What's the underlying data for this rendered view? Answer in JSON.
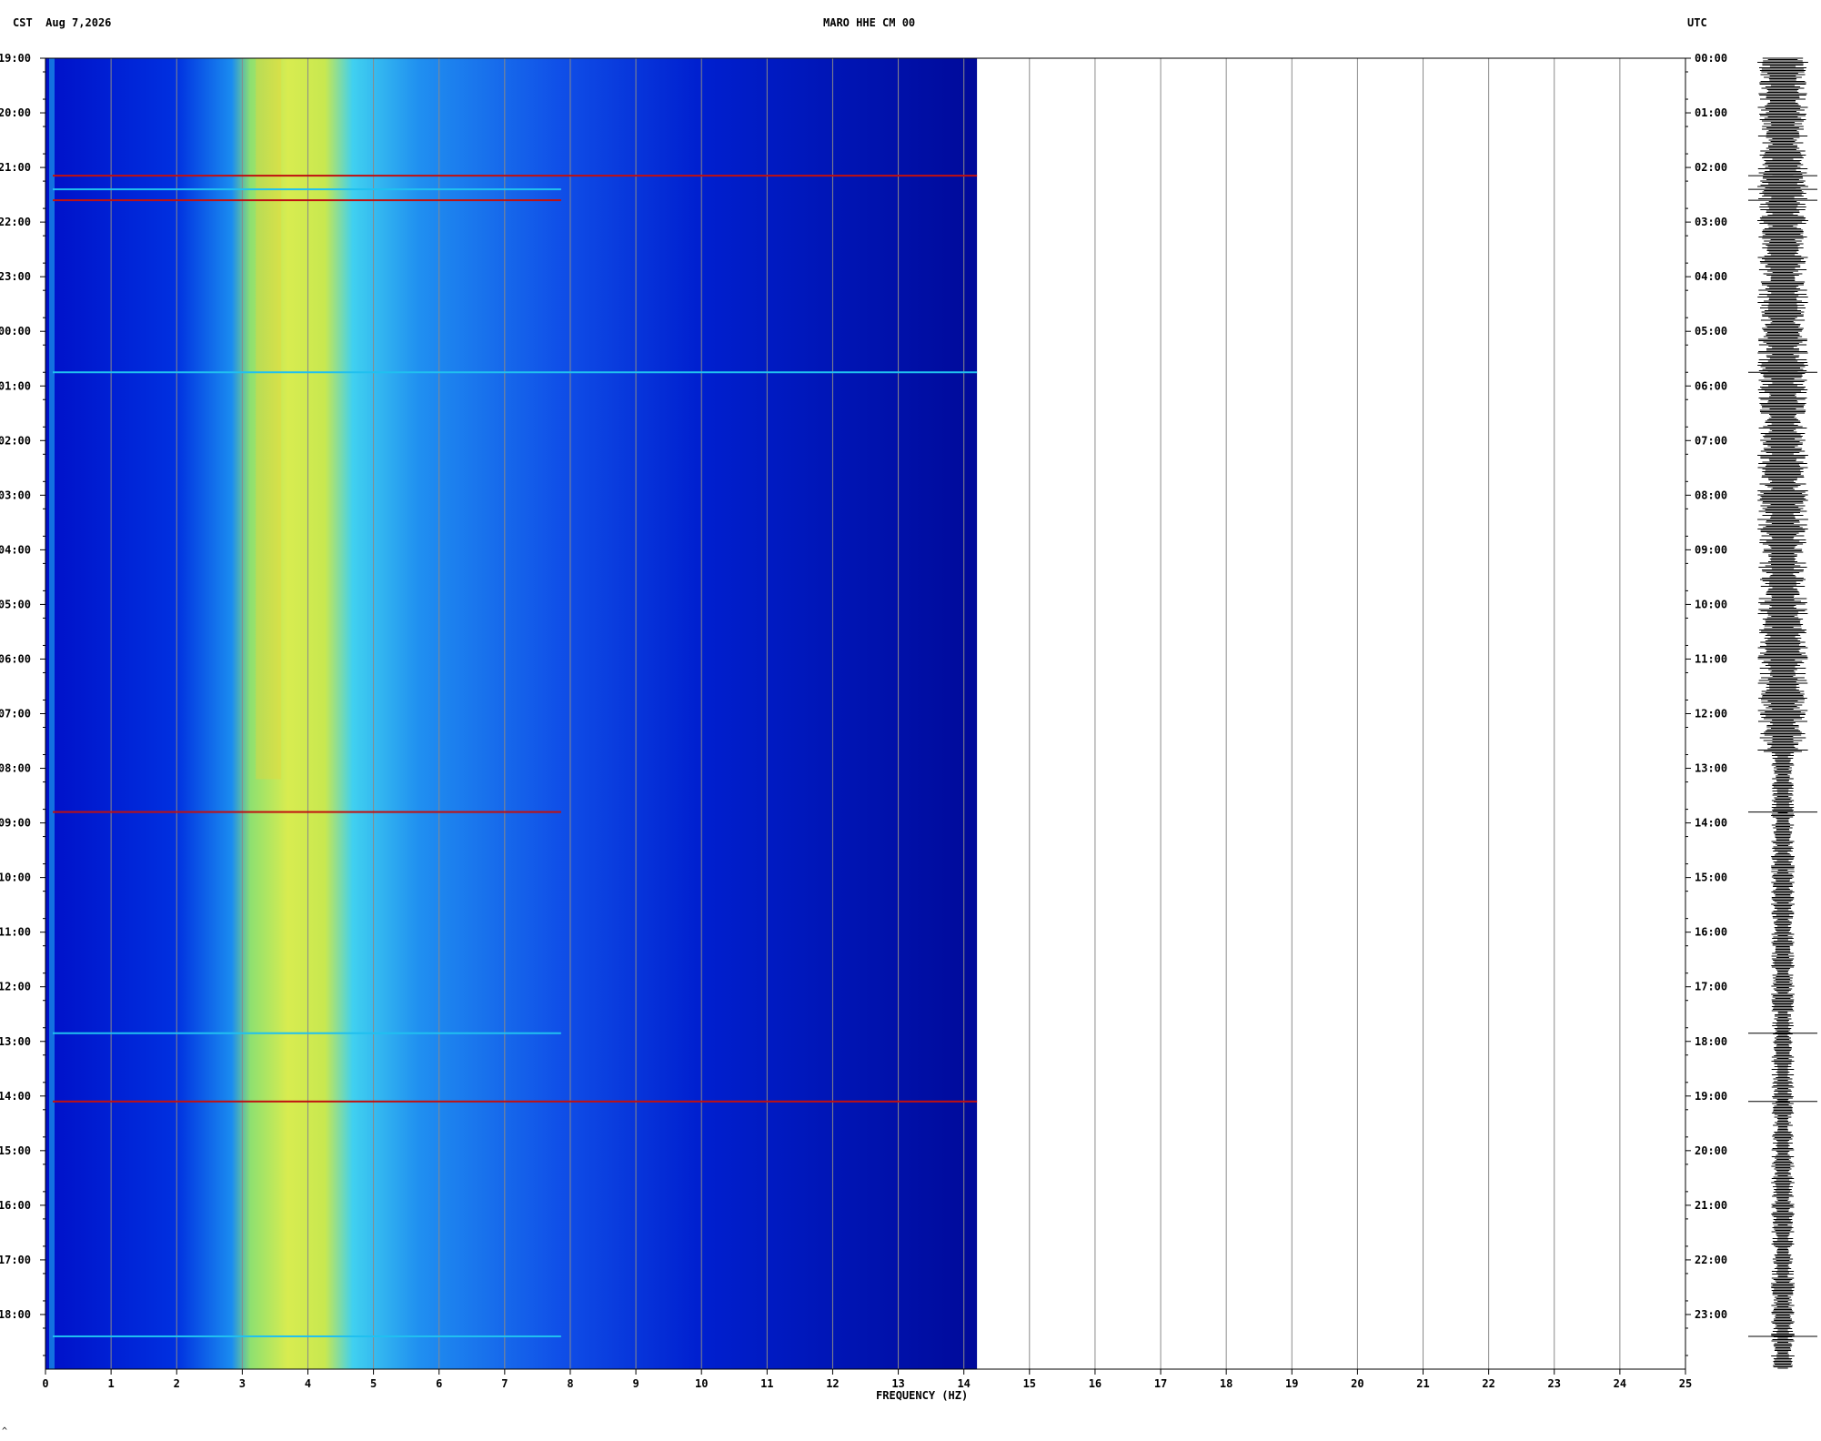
{
  "header": {
    "left_tz": "CST",
    "date": "Aug 7,2026",
    "station": "MARO HHE CM 00",
    "right_tz": "UTC"
  },
  "footnote": "^",
  "chart_data": {
    "type": "heatmap",
    "title": "MARO HHE CM 00",
    "xlabel": "FREQUENCY (HZ)",
    "x_ticks": [
      0,
      1,
      2,
      3,
      4,
      5,
      6,
      7,
      8,
      9,
      10,
      11,
      12,
      13,
      14,
      15,
      16,
      17,
      18,
      19,
      20,
      21,
      22,
      23,
      24,
      25
    ],
    "xlim": [
      0,
      25
    ],
    "data_extent_hz": 14.2,
    "left_axis_label": "CST",
    "left_time_ticks": [
      "19:00",
      "20:00",
      "21:00",
      "22:00",
      "23:00",
      "00:00",
      "01:00",
      "02:00",
      "03:00",
      "04:00",
      "05:00",
      "06:00",
      "07:00",
      "08:00",
      "09:00",
      "10:00",
      "11:00",
      "12:00",
      "13:00",
      "14:00",
      "15:00",
      "16:00",
      "17:00",
      "18:00"
    ],
    "right_axis_label": "UTC",
    "right_time_ticks": [
      "00:00",
      "01:00",
      "02:00",
      "03:00",
      "04:00",
      "05:00",
      "06:00",
      "07:00",
      "08:00",
      "09:00",
      "10:00",
      "11:00",
      "12:00",
      "13:00",
      "14:00",
      "15:00",
      "16:00",
      "17:00",
      "18:00",
      "19:00",
      "20:00",
      "21:00",
      "22:00",
      "23:00"
    ],
    "energy_band_hz": [
      2.9,
      4.0
    ],
    "dominant_peak_hz": 3.4,
    "events_hours_after_start": [
      2.15,
      2.4,
      2.6,
      5.75,
      13.8,
      17.85,
      19.1,
      23.4
    ],
    "grid": true,
    "colormap": [
      "#00007a",
      "#0010c8",
      "#1060f0",
      "#20c0f0",
      "#c0f040",
      "#f0c020",
      "#c01010"
    ]
  }
}
